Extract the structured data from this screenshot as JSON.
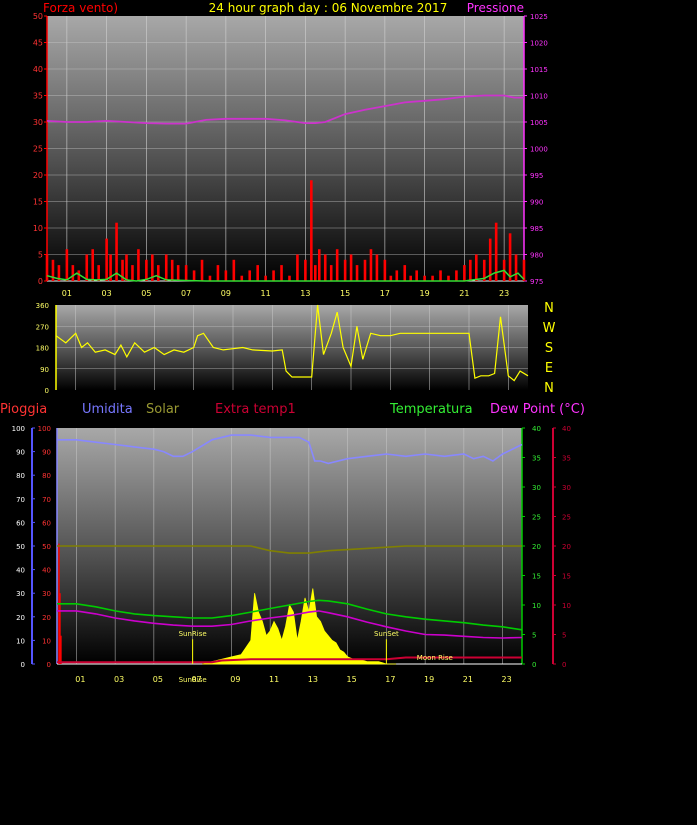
{
  "header": {
    "title": "24 hour graph day : 06 Novembre 2017",
    "left_label": "Forza vento)",
    "right_label": "Pressione"
  },
  "legend": {
    "pioggia": "Pioggia",
    "umidita": "Umidita",
    "solar": "Solar",
    "extra_temp": "Extra temp1",
    "temperatura": "Temperatura",
    "dew_point": "Dew Point (°C)"
  },
  "annotations": {
    "sunrise": "SunRise",
    "sunset": "SunSet",
    "moonrise": "Moon Rise"
  },
  "colors": {
    "wind": "#ff0000",
    "gust": "#ff0000",
    "wind_avg": "#33dd33",
    "pressure": "#cc33cc",
    "direction": "#ffff00",
    "humidity": "#8888ff",
    "solar": "#ffff00",
    "solar_avg": "#808000",
    "temperature": "#00cc00",
    "dew_point": "#cc00cc",
    "rain": "#ff0000",
    "extra_temp": "#cc0033"
  },
  "chart_data": [
    {
      "type": "line",
      "id": "wind_pressure",
      "x_ticks": [
        "01",
        "03",
        "05",
        "07",
        "09",
        "11",
        "13",
        "15",
        "17",
        "19",
        "21",
        "23"
      ],
      "x_range": [
        0,
        24
      ],
      "y_left": {
        "ticks": [
          "0",
          "5",
          "10",
          "15",
          "20",
          "25",
          "30",
          "35",
          "40",
          "45",
          "50"
        ],
        "range": [
          0,
          50
        ]
      },
      "y_right": {
        "ticks": [
          "975",
          "980",
          "985",
          "990",
          "995",
          "1000",
          "1005",
          "1010",
          "1015",
          "1020",
          "1025"
        ],
        "range": [
          975,
          1025
        ]
      },
      "series": [
        {
          "key": "pressure",
          "axis": "right",
          "x": [
            0,
            1,
            2,
            3,
            4,
            5,
            6,
            7,
            8,
            9,
            10,
            11,
            12,
            13,
            13.5,
            14,
            15,
            16,
            17,
            18,
            19,
            20,
            21,
            22,
            23,
            23.5,
            24
          ],
          "values": [
            1005.2,
            1005.0,
            1005.0,
            1005.2,
            1005.0,
            1004.8,
            1004.7,
            1004.7,
            1005.4,
            1005.6,
            1005.6,
            1005.6,
            1005.3,
            1004.8,
            1004.8,
            1005.0,
            1006.5,
            1007.3,
            1008.0,
            1008.7,
            1009.0,
            1009.3,
            1009.8,
            1010.0,
            1010.0,
            1009.6,
            1009.6
          ]
        },
        {
          "key": "wind_avg",
          "axis": "left",
          "x": [
            0,
            0.5,
            1,
            1.5,
            2,
            2.5,
            3,
            3.5,
            4,
            4.5,
            5,
            5.5,
            6,
            7,
            8,
            10,
            12,
            14,
            16,
            18,
            20,
            21,
            22,
            22.5,
            23,
            23.3,
            23.7,
            24
          ],
          "values": [
            1.0,
            0.5,
            0.2,
            1.5,
            0.3,
            0.2,
            0.3,
            1.5,
            0.2,
            0.0,
            0.3,
            1.0,
            0.2,
            0.1,
            0.0,
            0.0,
            0.0,
            0.0,
            0.0,
            0.0,
            0.0,
            0.0,
            0.5,
            1.5,
            2.0,
            0.8,
            1.5,
            0.3
          ]
        }
      ],
      "gust_series": {
        "key": "gust",
        "axis": "left",
        "x": [
          0,
          0.3,
          0.6,
          1,
          1.3,
          1.6,
          2,
          2.3,
          2.6,
          3,
          3.2,
          3.5,
          3.8,
          4,
          4.3,
          4.6,
          5,
          5.3,
          5.6,
          6,
          6.3,
          6.6,
          7,
          7.4,
          7.8,
          8.2,
          8.6,
          9,
          9.4,
          9.8,
          10.2,
          10.6,
          11,
          11.4,
          11.8,
          12.2,
          12.6,
          13,
          13.3,
          13.5,
          13.7,
          14,
          14.3,
          14.6,
          15,
          15.3,
          15.6,
          16,
          16.3,
          16.6,
          17,
          17.3,
          17.6,
          18,
          18.3,
          18.6,
          19,
          19.4,
          19.8,
          20.2,
          20.6,
          21,
          21.3,
          21.6,
          22,
          22.3,
          22.6,
          23,
          23.3,
          23.6,
          24
        ],
        "values": [
          5,
          4,
          3,
          6,
          3,
          2,
          5,
          6,
          3,
          8,
          5,
          11,
          4,
          5,
          3,
          6,
          4,
          5,
          3,
          5,
          4,
          3,
          3,
          2,
          4,
          1,
          3,
          2,
          4,
          1,
          2,
          3,
          1,
          2,
          3,
          1,
          5,
          4,
          19,
          3,
          6,
          5,
          3,
          6,
          4,
          5,
          3,
          4,
          6,
          5,
          4,
          1,
          2,
          3,
          1,
          2,
          1,
          1,
          2,
          1,
          2,
          3,
          4,
          5,
          4,
          8,
          11,
          4,
          9,
          5,
          4
        ]
      }
    },
    {
      "type": "line",
      "id": "wind_direction",
      "y_ticks": [
        "0",
        "90",
        "180",
        "270",
        "360"
      ],
      "y_range": [
        0,
        360
      ],
      "compass": [
        "N",
        "W",
        "S",
        "E",
        "N"
      ],
      "series": [
        {
          "key": "direction",
          "x": [
            0,
            0.5,
            1,
            1.3,
            1.6,
            2,
            2.5,
            3,
            3.3,
            3.6,
            4,
            4.5,
            5,
            5.5,
            6,
            6.5,
            7,
            7.2,
            7.5,
            8,
            8.5,
            9,
            9.5,
            10,
            11,
            11.5,
            11.7,
            12,
            13,
            13.3,
            13.6,
            14,
            14.3,
            14.6,
            15,
            15.3,
            15.6,
            16,
            16.5,
            17,
            17.5,
            18,
            19,
            20,
            21,
            21.3,
            21.6,
            22,
            22.3,
            22.6,
            23,
            23.3,
            23.6,
            24
          ],
          "values": [
            230,
            200,
            240,
            180,
            200,
            160,
            170,
            150,
            190,
            140,
            200,
            160,
            180,
            150,
            170,
            160,
            180,
            230,
            240,
            180,
            170,
            175,
            180,
            170,
            165,
            170,
            80,
            55,
            55,
            360,
            150,
            240,
            330,
            180,
            100,
            270,
            130,
            240,
            230,
            230,
            240,
            240,
            240,
            240,
            240,
            50,
            60,
            60,
            70,
            310,
            60,
            40,
            80,
            60
          ]
        }
      ]
    },
    {
      "type": "line",
      "id": "temp_humidity_solar",
      "x_ticks": [
        "01",
        "03",
        "05",
        "07",
        "09",
        "11",
        "13",
        "15",
        "17",
        "19",
        "21",
        "23"
      ],
      "x_range": [
        0,
        24
      ],
      "y_left_outer": {
        "ticks": [
          "0",
          "10",
          "20",
          "30",
          "40",
          "50",
          "60",
          "70",
          "80",
          "90",
          "100"
        ],
        "range": [
          0,
          100
        ]
      },
      "y_left_inner": {
        "ticks": [
          "0",
          "10",
          "20",
          "30",
          "40",
          "50",
          "60",
          "70",
          "80",
          "90",
          "100"
        ],
        "range": [
          0,
          100
        ]
      },
      "y_right_inner": {
        "ticks": [
          "0",
          "5",
          "10",
          "15",
          "20",
          "25",
          "30",
          "35",
          "40"
        ],
        "range": [
          0,
          40
        ]
      },
      "y_right_outer": {
        "ticks": [
          "0",
          "5",
          "10",
          "15",
          "20",
          "25",
          "30",
          "35",
          "40"
        ],
        "range": [
          0,
          40
        ]
      },
      "series": [
        {
          "key": "humidity",
          "axis": "left",
          "x": [
            0,
            1,
            2,
            3,
            4,
            5,
            5.5,
            6,
            6.5,
            7,
            8,
            9,
            10,
            11,
            12,
            12.5,
            13,
            13.3,
            13.6,
            14,
            15,
            16,
            17,
            18,
            19,
            20,
            21,
            21.5,
            22,
            22.5,
            23,
            24
          ],
          "values": [
            95,
            95,
            94,
            93,
            92,
            91,
            90,
            88,
            88,
            90,
            95,
            97,
            97,
            96,
            96,
            96,
            94,
            86,
            86,
            85,
            87,
            88,
            89,
            88,
            89,
            88,
            89,
            87,
            88,
            86,
            89,
            93
          ]
        },
        {
          "key": "solar_avg",
          "axis": "left",
          "x": [
            0,
            2,
            4,
            6,
            8,
            10,
            11,
            12,
            13,
            14,
            16,
            18,
            20,
            22,
            24
          ],
          "values": [
            50,
            50,
            50,
            50,
            50,
            50,
            48,
            47,
            47,
            48,
            49,
            50,
            50,
            50,
            50
          ]
        },
        {
          "key": "temperature",
          "axis": "right",
          "x": [
            0,
            1,
            2,
            3,
            4,
            5,
            6,
            7,
            8,
            9,
            10,
            11,
            12,
            13,
            13.5,
            14,
            15,
            16,
            17,
            18,
            19,
            20,
            21,
            22,
            23,
            24
          ],
          "values": [
            10.2,
            10.2,
            9.7,
            9.0,
            8.5,
            8.2,
            8.0,
            7.8,
            7.8,
            8.2,
            8.8,
            9.4,
            10.0,
            10.6,
            10.8,
            10.7,
            10.2,
            9.3,
            8.5,
            8.0,
            7.6,
            7.3,
            7.0,
            6.6,
            6.3,
            5.8
          ]
        },
        {
          "key": "dew_point",
          "axis": "right",
          "x": [
            0,
            1,
            2,
            3,
            4,
            5,
            6,
            7,
            8,
            9,
            10,
            11,
            12,
            13,
            13.5,
            14,
            15,
            16,
            17,
            18,
            19,
            20,
            21,
            22,
            23,
            24
          ],
          "values": [
            9.0,
            9.0,
            8.5,
            7.8,
            7.3,
            6.9,
            6.6,
            6.4,
            6.4,
            6.7,
            7.3,
            7.8,
            8.2,
            8.8,
            9.0,
            8.7,
            8.0,
            7.1,
            6.3,
            5.6,
            5.0,
            4.9,
            4.7,
            4.5,
            4.4,
            4.5
          ]
        },
        {
          "key": "extra_temp",
          "axis": "right",
          "x": [
            0,
            8,
            8.5,
            10,
            13,
            17,
            18,
            24
          ],
          "values": [
            0.3,
            0.3,
            0.6,
            0.8,
            0.8,
            0.8,
            1.1,
            1.1
          ]
        }
      ],
      "rain": {
        "key": "rain",
        "axis": "left_outer",
        "x": [
          0.05,
          0.1,
          0.15
        ],
        "values": [
          51,
          30,
          12
        ]
      },
      "solar": {
        "key": "solar",
        "axis": "left",
        "x": [
          7.5,
          8,
          8.5,
          9,
          9.5,
          10,
          10.2,
          10.4,
          10.6,
          10.8,
          11,
          11.2,
          11.4,
          11.6,
          11.8,
          12,
          12.2,
          12.4,
          12.6,
          12.8,
          13,
          13.2,
          13.4,
          13.6,
          13.8,
          14,
          14.2,
          14.4,
          14.6,
          14.8,
          15,
          15.3,
          15.6,
          16,
          16.3,
          16.6,
          17,
          17.5
        ],
        "values": [
          0,
          1,
          2,
          3,
          4,
          10,
          30,
          22,
          18,
          12,
          14,
          18,
          15,
          10,
          16,
          25,
          22,
          10,
          18,
          28,
          22,
          32,
          20,
          18,
          14,
          12,
          10,
          9,
          6,
          5,
          3,
          2,
          2,
          1,
          1,
          1,
          0,
          0
        ]
      },
      "markers": [
        {
          "label_key": "sunrise",
          "x": 7.0,
          "y": 10.5
        },
        {
          "label_key": "sunset",
          "x": 17.0,
          "y": 10.5
        },
        {
          "label_key": "moonrise",
          "x": 19.5,
          "y": 0.5
        }
      ]
    }
  ]
}
